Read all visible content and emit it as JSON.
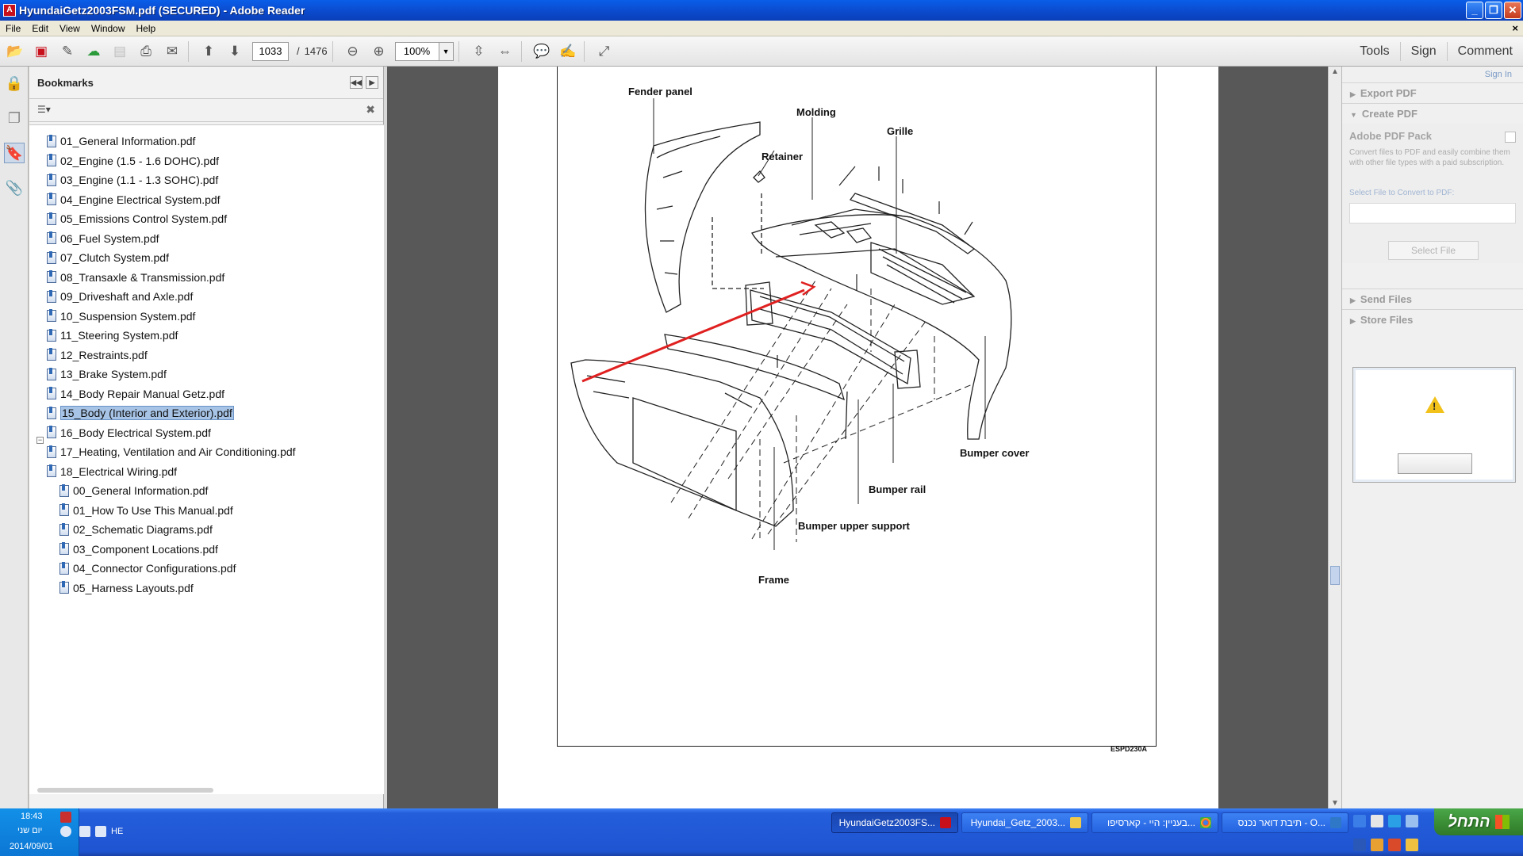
{
  "window": {
    "title": "HyundaiGetz2003FSM.pdf (SECURED) - Adobe Reader",
    "app_icon_color": "#c8101c"
  },
  "menu": [
    "File",
    "Edit",
    "View",
    "Window",
    "Help"
  ],
  "toolbar": {
    "current_page": "1033",
    "page_separator": "/",
    "total_pages": "1476",
    "zoom": "100%",
    "links": [
      "Tools",
      "Sign",
      "Comment"
    ]
  },
  "bookmarks": {
    "title": "Bookmarks",
    "selected_index": 14,
    "items": [
      "01_General Information.pdf",
      "02_Engine (1.5 - 1.6 DOHC).pdf",
      "03_Engine (1.1 - 1.3 SOHC).pdf",
      "04_Engine Electrical System.pdf",
      "05_Emissions Control System.pdf",
      "06_Fuel System.pdf",
      "07_Clutch System.pdf",
      "08_Transaxle & Transmission.pdf",
      "09_Driveshaft and Axle.pdf",
      "10_Suspension System.pdf",
      "11_Steering System.pdf",
      "12_Restraints.pdf",
      "13_Brake System.pdf",
      "14_Body Repair Manual Getz.pdf",
      "15_Body (Interior and Exterior).pdf",
      "16_Body Electrical System.pdf",
      "17_Heating, Ventilation and Air Conditioning.pdf",
      "18_Electrical Wiring.pdf"
    ],
    "children": [
      "00_General Information.pdf",
      "01_How To Use This Manual.pdf",
      "02_Schematic Diagrams.pdf",
      "03_Component Locations.pdf",
      "04_Connector Configurations.pdf",
      "05_Harness Layouts.pdf"
    ]
  },
  "diagram": {
    "labels": {
      "fender_panel": "Fender panel",
      "molding": "Molding",
      "grille": "Grille",
      "retainer": "Retainer",
      "bumper_cover": "Bumper cover",
      "bumper_rail": "Bumper rail",
      "bumper_upper_support": "Bumper upper support",
      "frame": "Frame"
    },
    "figure_id": "ESPD230A",
    "arrow_color": "#e02020"
  },
  "right_pane": {
    "sign_in": "Sign In",
    "sections": [
      "Export PDF",
      "Create PDF",
      "Send Files",
      "Store Files"
    ],
    "pack_title": "Adobe PDF Pack",
    "pack_desc": "Convert files to PDF and easily combine them with other file types with a paid subscription.",
    "select_label": "Select File to Convert to PDF:",
    "select_button": "Select File"
  },
  "taskbar": {
    "time": "18:43",
    "day": "יום שני",
    "date": "2014/09/01",
    "lang": "HE",
    "tasks": [
      "HyundaiGetz2003FS...",
      "Hyundai_Getz_2003...",
      "בעניין: היי - קארסיפו...",
      "תיבת דואר נכנס - O..."
    ],
    "start": "התחל"
  }
}
